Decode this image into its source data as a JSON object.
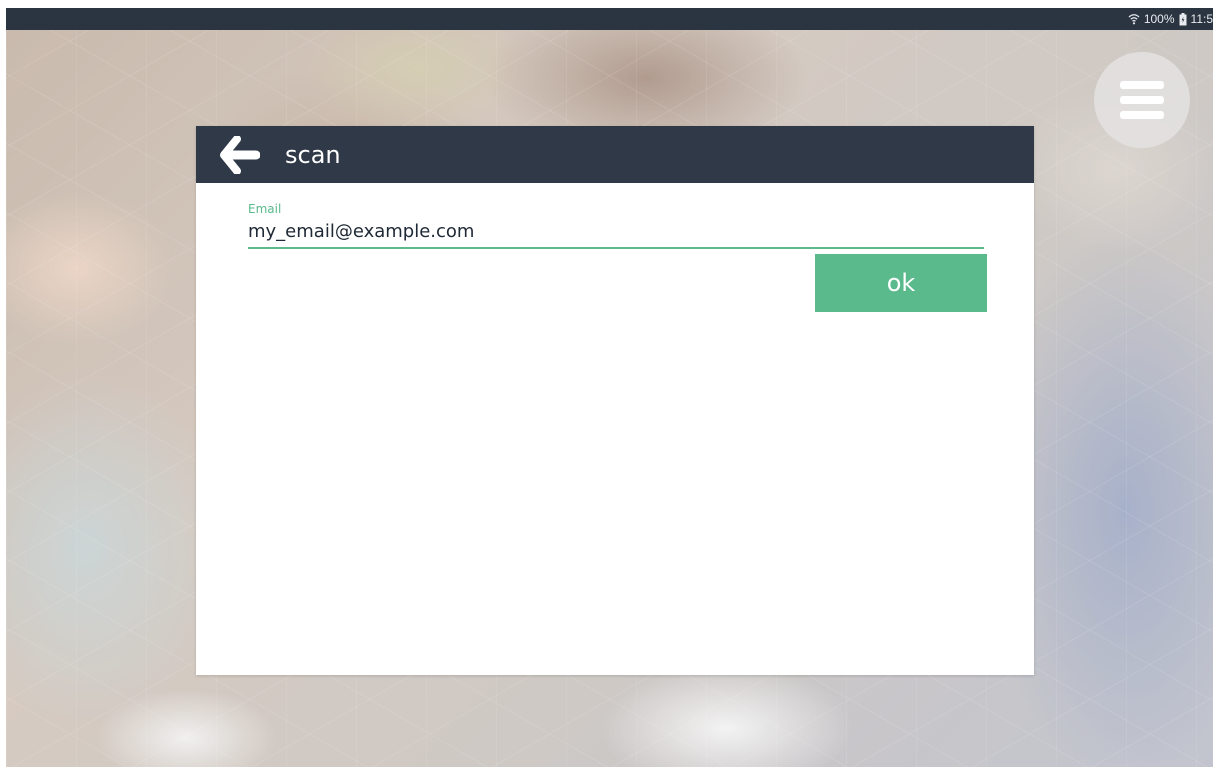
{
  "status_bar": {
    "wifi_icon": "wifi-icon",
    "battery_text": "100%",
    "battery_icon": "battery-icon",
    "time": "11:5"
  },
  "menu": {
    "icon": "hamburger-menu-icon"
  },
  "dialog": {
    "title": "scan",
    "back_icon": "arrow-left-icon",
    "email_label": "Email",
    "email_value": "my_email@example.com",
    "ok_label": "ok"
  },
  "colors": {
    "header_bg": "#2f3947",
    "status_bar_bg": "#2b3441",
    "accent_green": "#5aba8c",
    "dialog_bg": "#ffffff"
  }
}
